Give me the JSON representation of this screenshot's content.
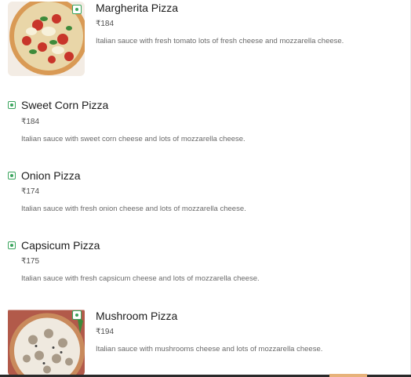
{
  "currency_symbol": "₹",
  "veg_color": "#3aa55d",
  "items": [
    {
      "name": "Margherita Pizza",
      "price": "₹184",
      "description": "Italian sauce with fresh tomato lots of fresh cheese and mozzarella cheese.",
      "has_image": true,
      "veg_icon": "veg-indicator-icon"
    },
    {
      "name": "Sweet Corn Pizza",
      "price": "₹184",
      "description": "Italian sauce with sweet corn cheese and lots of mozzarella cheese.",
      "has_image": false,
      "veg_icon": "veg-indicator-icon"
    },
    {
      "name": "Onion Pizza",
      "price": "₹174",
      "description": "Italian sauce with fresh onion cheese and lots of mozzarella cheese.",
      "has_image": false,
      "veg_icon": "veg-indicator-icon"
    },
    {
      "name": "Capsicum Pizza",
      "price": "₹175",
      "description": "Italian sauce with fresh capsicum cheese and lots of mozzarella cheese.",
      "has_image": false,
      "veg_icon": "veg-indicator-icon"
    },
    {
      "name": "Mushroom Pizza",
      "price": "₹194",
      "description": "Italian sauce with mushrooms cheese and lots of mozzarella cheese.",
      "has_image": true,
      "veg_icon": "veg-indicator-icon"
    }
  ]
}
